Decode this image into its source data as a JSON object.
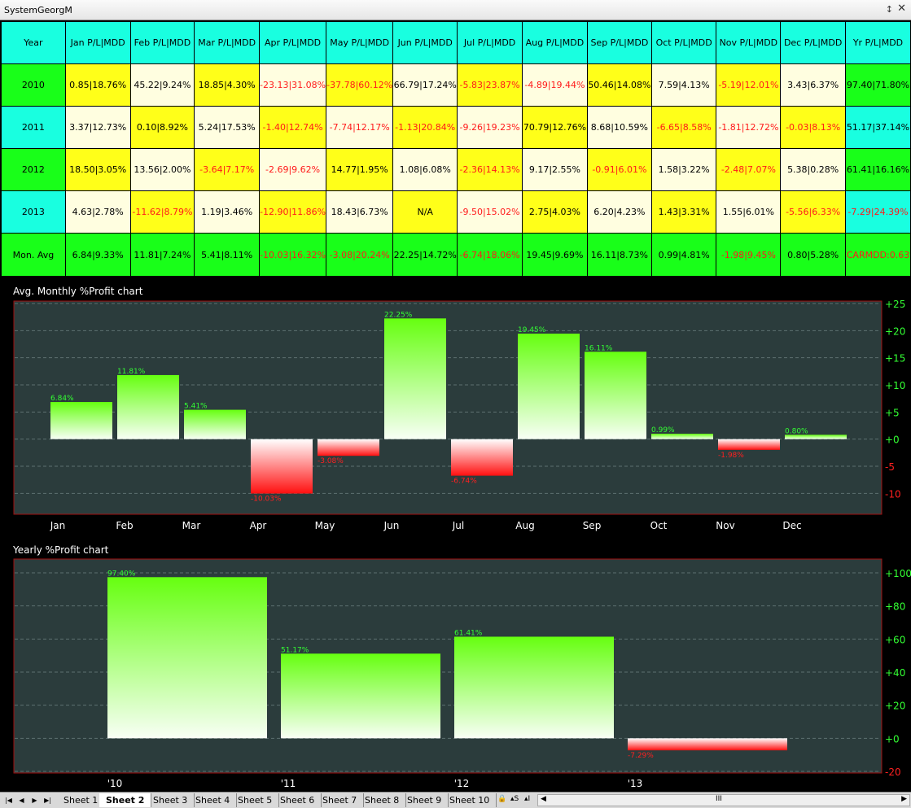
{
  "window": {
    "title": "SystemGeorgM",
    "pin_glyph": "↕",
    "close_glyph": "✕"
  },
  "table": {
    "headers": [
      "Year",
      "Jan P/L|MDD",
      "Feb P/L|MDD",
      "Mar P/L|MDD",
      "Apr P/L|MDD",
      "May P/L|MDD",
      "Jun P/L|MDD",
      "Jul P/L|MDD",
      "Aug P/L|MDD",
      "Sep P/L|MDD",
      "Oct P/L|MDD",
      "Nov P/L|MDD",
      "Dec P/L|MDD",
      "Yr P/L|MDD"
    ],
    "rows": [
      {
        "year": "2010",
        "cells": [
          "0.85|18.76%",
          "45.22|9.24%",
          "18.85|4.30%",
          "-23.13|31.08%",
          "-37.78|60.12%",
          "66.79|17.24%",
          "-5.83|23.87%",
          "-4.89|19.44%",
          "50.46|14.08%",
          "7.59|4.13%",
          "-5.19|12.01%",
          "3.43|6.37%",
          "97.40|71.80%"
        ]
      },
      {
        "year": "2011",
        "cells": [
          "3.37|12.73%",
          "0.10|8.92%",
          "5.24|17.53%",
          "-1.40|12.74%",
          "-7.74|12.17%",
          "-1.13|20.84%",
          "-9.26|19.23%",
          "70.79|12.76%",
          "8.68|10.59%",
          "-6.65|8.58%",
          "-1.81|12.72%",
          "-0.03|8.13%",
          "51.17|37.14%"
        ]
      },
      {
        "year": "2012",
        "cells": [
          "18.50|3.05%",
          "13.56|2.00%",
          "-3.64|7.17%",
          "-2.69|9.62%",
          "14.77|1.95%",
          "1.08|6.08%",
          "-2.36|14.13%",
          "9.17|2.55%",
          "-0.91|6.01%",
          "1.58|3.22%",
          "-2.48|7.07%",
          "5.38|0.28%",
          "61.41|16.16%"
        ]
      },
      {
        "year": "2013",
        "cells": [
          "4.63|2.78%",
          "-11.62|8.79%",
          "1.19|3.46%",
          "-12.90|11.86%",
          "18.43|6.73%",
          "N/A",
          "-9.50|15.02%",
          "2.75|4.03%",
          "6.20|4.23%",
          "1.43|3.31%",
          "1.55|6.01%",
          "-5.56|6.33%",
          "-7.29|24.39%"
        ]
      }
    ],
    "avg_row": {
      "label": "Mon. Avg",
      "cells": [
        "6.84|9.33%",
        "11.81|7.24%",
        "5.41|8.11%",
        "-10.03|16.32%",
        "-3.08|20.24%",
        "22.25|14.72%",
        "-6.74|18.06%",
        "19.45|9.69%",
        "16.11|8.73%",
        "0.99|4.81%",
        "-1.98|9.45%",
        "0.80|5.28%",
        "CARMDD:0.63"
      ]
    }
  },
  "colors": {
    "cyan": "#19ffe0",
    "green": "#19ff19",
    "yellow": "#ffff19",
    "cream": "#fffee0",
    "negative": "#ff1a1a",
    "chart_bg": "#2b3c3c",
    "chart_border": "#a01010",
    "pos_label": "#33ff33",
    "neg_label": "#ff2020"
  },
  "chart_data": [
    {
      "type": "bar",
      "title": "Avg. Monthly %Profit chart",
      "categories": [
        "Jan",
        "Feb",
        "Mar",
        "Apr",
        "May",
        "Jun",
        "Jul",
        "Aug",
        "Sep",
        "Oct",
        "Nov",
        "Dec"
      ],
      "values": [
        6.84,
        11.81,
        5.41,
        -10.03,
        -3.08,
        22.25,
        -6.74,
        19.45,
        16.11,
        0.99,
        -1.98,
        0.8
      ],
      "labels": [
        "6.84%",
        "11.81%",
        "5.41%",
        "-10.03%",
        "-3.08%",
        "22.25%",
        "-6.74%",
        "19.45%",
        "16.11%",
        "0.99%",
        "-1.98%",
        "0.80%"
      ],
      "ylim": [
        -12.5,
        25
      ],
      "yticks": [
        25,
        20,
        15,
        10,
        5,
        0,
        -5,
        -10
      ],
      "ytick_labels": [
        "+25",
        "+20",
        "+15",
        "+10",
        "+5",
        "+0",
        "-5",
        "-10"
      ],
      "grid": true,
      "xlabel": "",
      "ylabel": ""
    },
    {
      "type": "bar",
      "title": "Yearly %Profit chart",
      "categories": [
        "'10",
        "'11",
        "'12",
        "'13"
      ],
      "values": [
        97.4,
        51.17,
        61.41,
        -7.29
      ],
      "labels": [
        "97.40%",
        "51.17%",
        "61.41%",
        "-7.29%"
      ],
      "ylim": [
        -20,
        100
      ],
      "yticks": [
        100,
        80,
        60,
        40,
        20,
        0,
        -20
      ],
      "ytick_labels": [
        "+100",
        "+80",
        "+60",
        "+40",
        "+20",
        "+0",
        "-20"
      ],
      "grid": true,
      "xlabel": "",
      "ylabel": ""
    }
  ],
  "sheets": {
    "tabs": [
      "Sheet 1",
      "Sheet 2",
      "Sheet 3",
      "Sheet 4",
      "Sheet 5",
      "Sheet 6",
      "Sheet 7",
      "Sheet 8",
      "Sheet 9",
      "Sheet 10"
    ],
    "active": 1,
    "nav": [
      "|◀",
      "◀",
      "▶",
      "▶|"
    ],
    "tools": [
      "🔒",
      "▴S",
      "▴I"
    ],
    "scroll_thumb": "III"
  }
}
